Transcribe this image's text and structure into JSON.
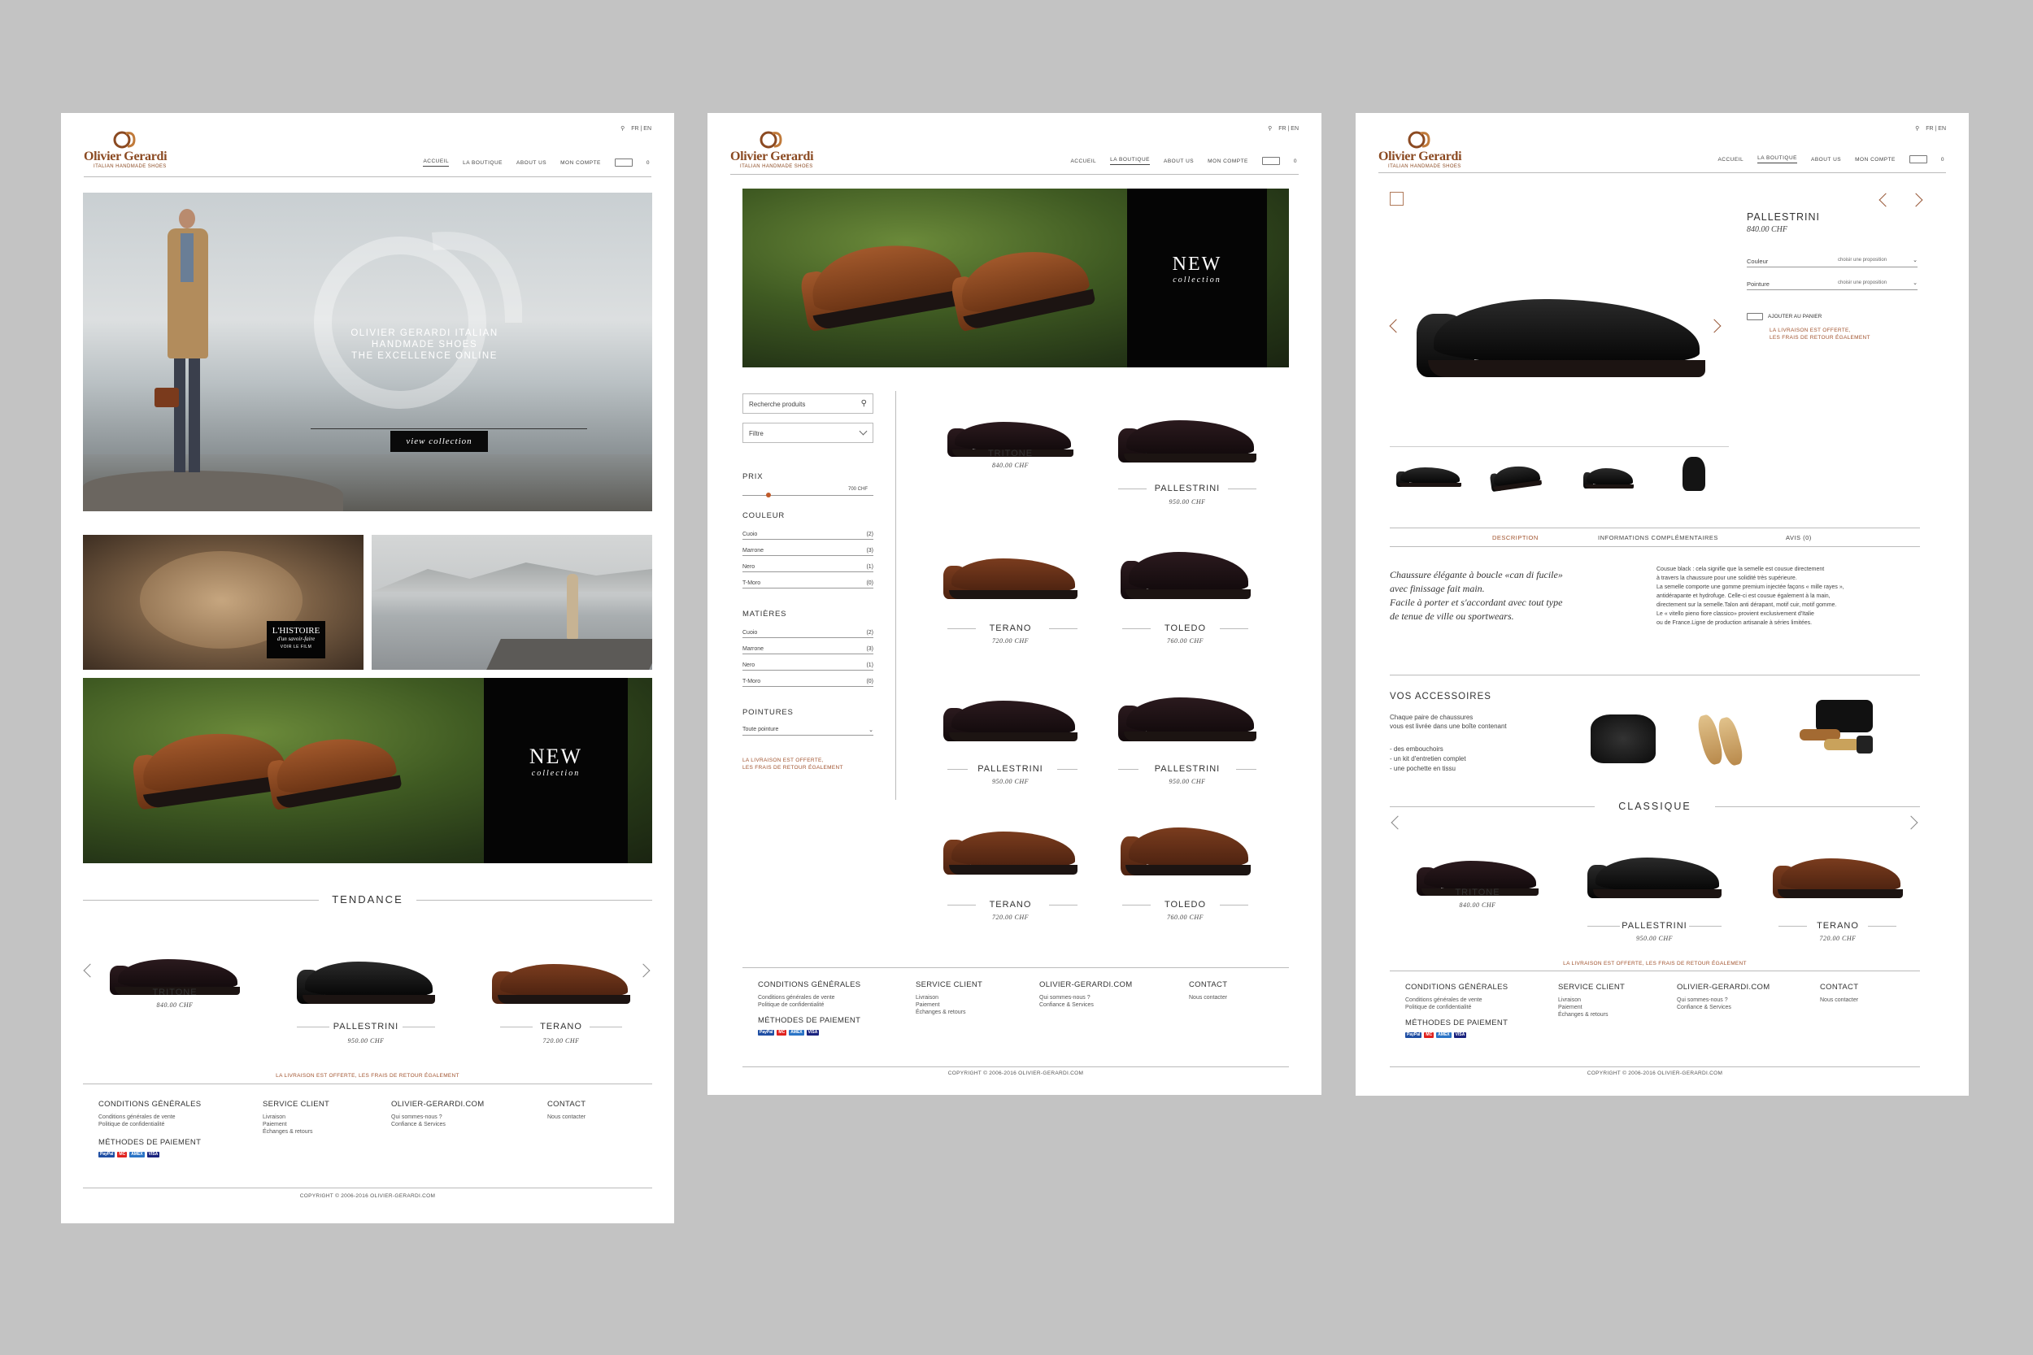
{
  "brand": {
    "name": "Olivier Gerardi",
    "tagline": "ITALIAN HANDMADE SHOES",
    "accent": "#8b4a22"
  },
  "lang": "FR | EN",
  "nav": {
    "home": "ACCUEIL",
    "shop": "LA BOUTIQUE",
    "about": "ABOUT US",
    "account": "MON COMPTE",
    "cart_count": "0"
  },
  "home": {
    "hero_line1": "OLIVIER GERARDI ITALIAN HANDMADE SHOES",
    "hero_line2": "THE EXCELLENCE ONLINE",
    "hero_button": "view collection",
    "history_title": "L'HISTOIRE",
    "history_sub": "d'un savoir-faire",
    "history_link": "VOIR LE FILM",
    "new_title": "NEW",
    "new_sub": "collection",
    "trend_title": "TENDANCE",
    "products": [
      {
        "name": "TRITONE",
        "price": "840.00 CHF"
      },
      {
        "name": "PALLESTRINI",
        "price": "950.00 CHF"
      },
      {
        "name": "TERANO",
        "price": "720.00 CHF"
      }
    ]
  },
  "shipping_note": "LA LIVRAISON EST OFFERTE, LES FRAIS DE RETOUR ÉGALEMENT",
  "shipping_note_split": [
    "LA LIVRAISON EST OFFERTE,",
    "LES FRAIS DE RETOUR ÉGALEMENT"
  ],
  "footer": {
    "col1_title": "CONDITIONS GÉNÉRALES",
    "col1_links": [
      "Conditions générales de vente",
      "Politique de confidentialité"
    ],
    "pay_title": "MÉTHODES DE PAIEMENT",
    "pay_methods": [
      "PayPal",
      "MC",
      "AMEX",
      "VISA"
    ],
    "col2_title": "SERVICE CLIENT",
    "col2_links": [
      "Livraison",
      "Paiement",
      "Échanges & retours"
    ],
    "col3_title": "OLIVIER-GERARDI.COM",
    "col3_links": [
      "Qui sommes-nous ?",
      "Confiance & Services"
    ],
    "col4_title": "CONTACT",
    "col4_links": [
      "Nous contacter"
    ],
    "copyright": "COPYRIGHT © 2006-2016 OLIVIER-GERARDI.COM"
  },
  "shop": {
    "banner_title": "NEW",
    "banner_sub": "collection",
    "search_placeholder": "Recherche produits",
    "filter_label": "Filtre",
    "price_title": "PRIX",
    "price_max": "700 CHF",
    "price_level": 0.2,
    "color_title": "COULEUR",
    "colors": [
      {
        "name": "Cuoio",
        "count": "(2)"
      },
      {
        "name": "Marrone",
        "count": "(3)"
      },
      {
        "name": "Nero",
        "count": "(1)"
      },
      {
        "name": "T-Moro",
        "count": "(0)"
      }
    ],
    "material_title": "MATIÈRES",
    "materials": [
      {
        "name": "Cuoio",
        "count": "(2)"
      },
      {
        "name": "Marrone",
        "count": "(3)"
      },
      {
        "name": "Nero",
        "count": "(1)"
      },
      {
        "name": "T-Moro",
        "count": "(0)"
      }
    ],
    "size_title": "POINTURES",
    "size_value": "Toute pointure",
    "products": [
      {
        "name": "TRITONE",
        "price": "840.00 CHF"
      },
      {
        "name": "PALLESTRINI",
        "price": "950.00 CHF"
      },
      {
        "name": "TERANO",
        "price": "720.00 CHF"
      },
      {
        "name": "TOLEDO",
        "price": "760.00 CHF"
      },
      {
        "name": "PALLESTRINI",
        "price": "950.00 CHF"
      },
      {
        "name": "PALLESTRINI",
        "price": "950.00 CHF"
      },
      {
        "name": "TERANO",
        "price": "720.00 CHF"
      },
      {
        "name": "TOLEDO",
        "price": "760.00 CHF"
      }
    ]
  },
  "product": {
    "name": "PALLESTRINI",
    "price": "840.00 CHF",
    "color_label": "Couleur",
    "size_label": "Pointure",
    "choose": "choisir une proposition",
    "add_to_cart": "AJOUTER AU PANIER",
    "tabs": [
      "DESCRIPTION",
      "INFORMATIONS COMPLÉMENTAIRES",
      "AVIS (0)"
    ],
    "desc_italic": [
      "Chaussure élégante à boucle «can di fucile»",
      "avec finissage fait main.",
      "Facile à porter et s'accordant avec tout type",
      "de tenue de ville ou sportwears."
    ],
    "desc_body": [
      "Cousue black : cela signifie que la semelle est cousue directement",
      "à travers la chaussure pour une solidité très supérieure.",
      "La semelle comporte une gomme premium injectée façons « mille rayes »,",
      "antidérapante et hydrofuge. Celle-ci est cousue également à la main,",
      "directement sur la semelle.Talon anti dérapant, motif cuir, motif gomme.",
      "Le « vitello pieno fiore classico» provient exclusivement d'Italie",
      "ou de France.Ligne de production artisanale à séries limitées."
    ],
    "acc_title": "VOS ACCESSOIRES",
    "acc_intro": [
      "Chaque paire de chaussures",
      "vous est livrée dans une boîte contenant"
    ],
    "acc_list": [
      "- des embouchoirs",
      "- un kit d'entretien complet",
      "- une pochette en tissu"
    ],
    "related_title": "CLASSIQUE",
    "related": [
      {
        "name": "TRITONE",
        "price": "840.00 CHF"
      },
      {
        "name": "PALLESTRINI",
        "price": "950.00 CHF"
      },
      {
        "name": "TERANO",
        "price": "720.00 CHF"
      }
    ]
  }
}
